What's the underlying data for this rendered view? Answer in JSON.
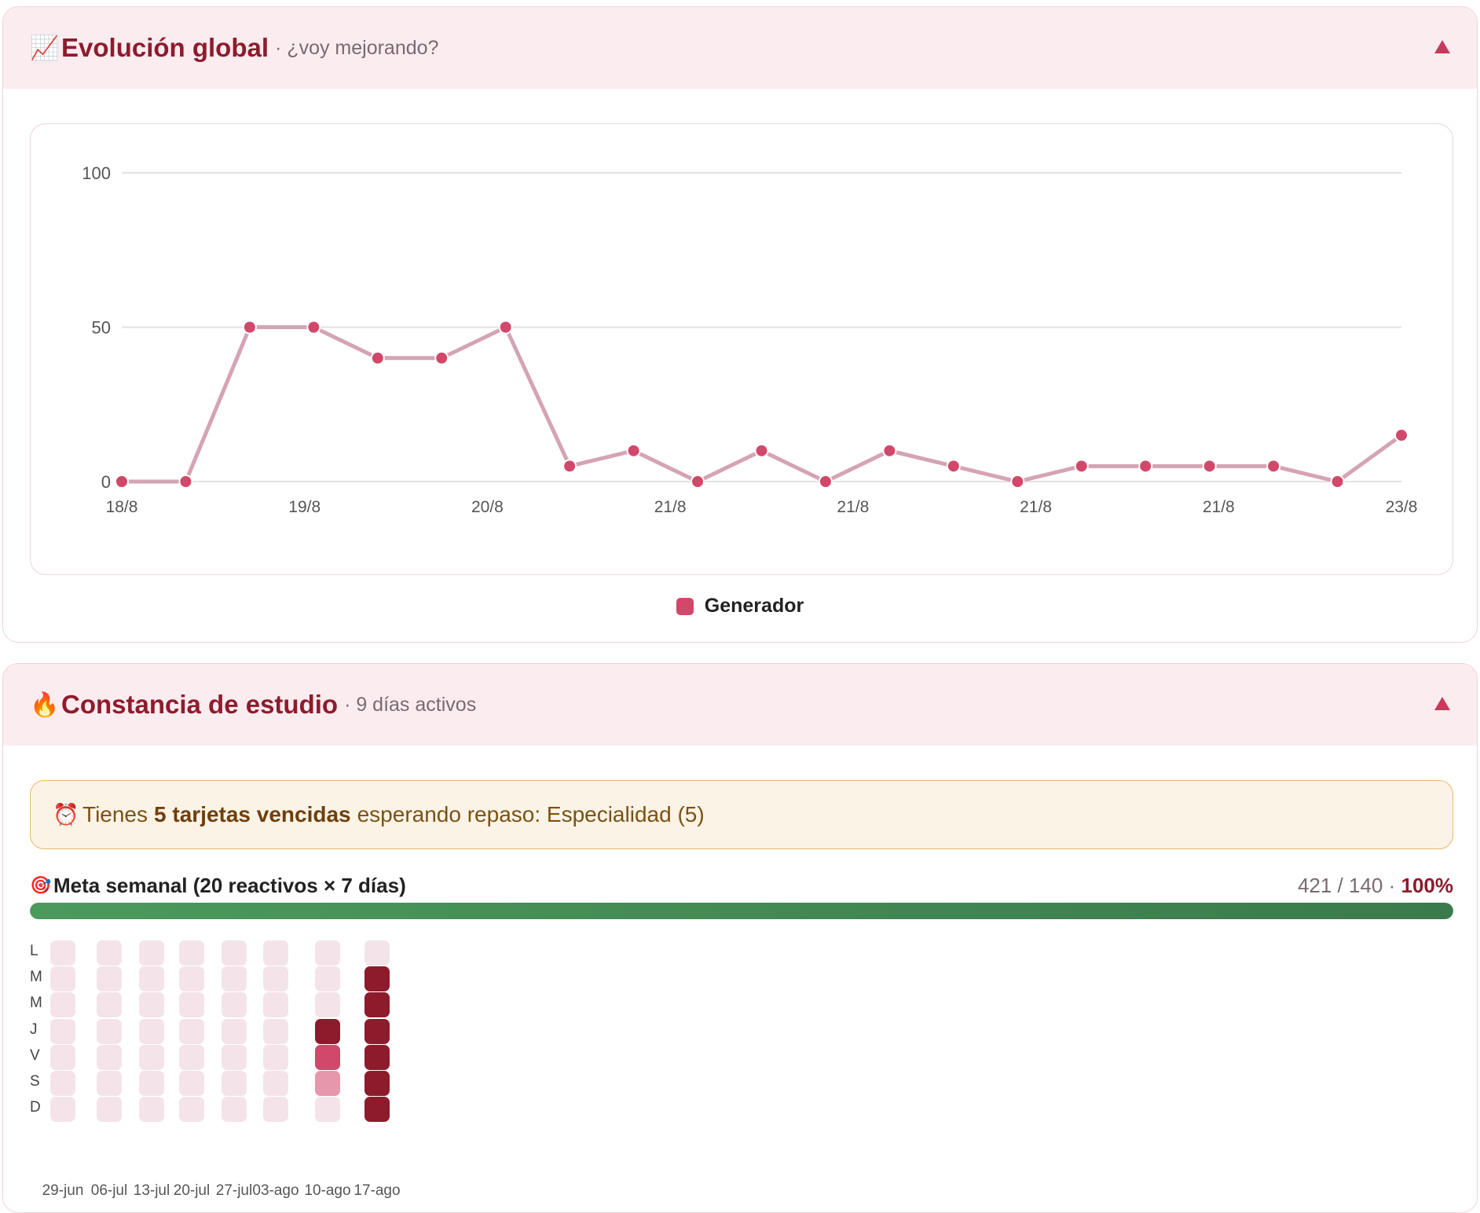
{
  "panel1": {
    "emoji": "📈",
    "title": "Evolución global",
    "subtitle": "· ¿voy mejorando?",
    "collapse_icon": "triangle-up"
  },
  "chart_data": {
    "type": "line",
    "x_ticks": [
      "18/8",
      "19/8",
      "20/8",
      "21/8",
      "21/8",
      "21/8",
      "21/8",
      "23/8"
    ],
    "y_ticks": [
      0,
      50,
      100
    ],
    "ylim": [
      0,
      100
    ],
    "grid": true,
    "legend_position": "bottom",
    "series": [
      {
        "name": "Generador",
        "color": "#d1486b",
        "line_color": "#d4a4b4",
        "values": [
          0,
          0,
          50,
          50,
          40,
          40,
          50,
          5,
          10,
          0,
          10,
          0,
          10,
          5,
          0,
          5,
          5,
          5,
          5,
          0,
          15
        ]
      }
    ]
  },
  "panel2": {
    "emoji": "🔥",
    "title": "Constancia de estudio",
    "subtitle": "· 9 días activos",
    "collapse_icon": "triangle-up",
    "alert": {
      "icon": "⏰",
      "pre": "Tienes",
      "bold": "5 tarjetas vencidas",
      "post": "esperando repaso: Especialidad (5)"
    },
    "goal": {
      "icon": "🎯",
      "label": "Meta semanal (20 reactivos × 7 días)",
      "stats": "421 / 140 ·",
      "percent": "100%",
      "progress": 1.0
    },
    "heatmap": {
      "days": [
        "L",
        "M",
        "M",
        "J",
        "V",
        "S",
        "D"
      ],
      "weeks": [
        "29-jun",
        "06-jul",
        "13-jul",
        "20-jul",
        "27-jul",
        "03-ago",
        "10-ago",
        "17-ago"
      ],
      "levels": [
        [
          0,
          0,
          0,
          0,
          0,
          0,
          0
        ],
        [
          0,
          0,
          0,
          0,
          0,
          0,
          0
        ],
        [
          0,
          0,
          0,
          0,
          0,
          0,
          0
        ],
        [
          0,
          0,
          0,
          0,
          0,
          0,
          0
        ],
        [
          0,
          0,
          0,
          0,
          0,
          0,
          0
        ],
        [
          0,
          0,
          0,
          0,
          0,
          0,
          0
        ],
        [
          0,
          0,
          0,
          3,
          2,
          1,
          0
        ],
        [
          0,
          3,
          3,
          3,
          3,
          3,
          3
        ]
      ]
    }
  }
}
